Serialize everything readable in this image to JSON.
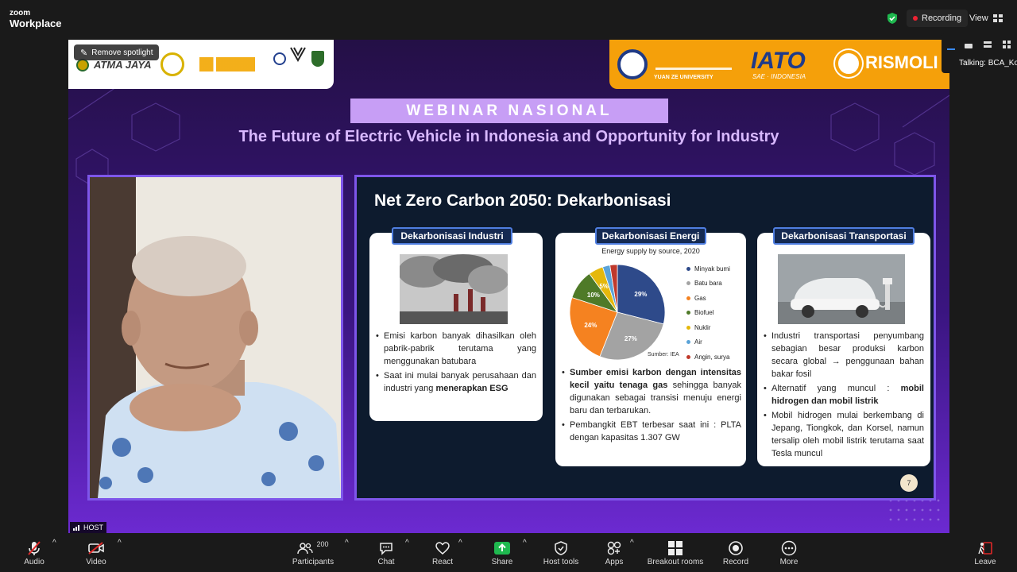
{
  "app": {
    "brand_top": "zoom",
    "brand_bottom": "Workplace"
  },
  "status": {
    "recording_label": "Recording",
    "view_label": "View"
  },
  "spotlight": {
    "remove_label": "Remove spotlight"
  },
  "banner": {
    "left_logos": [
      "ATMA JAYA"
    ],
    "right_logos": [
      "YUAN ZE UNIVERSITY",
      "IATO",
      "SAE · INDONESIA",
      "RISMOLI"
    ],
    "tag": "WEBINAR NASIONAL",
    "title": "The Future of Electric Vehicle in Indonesia and Opportunity for Industry"
  },
  "talking": {
    "label": "Talking:",
    "name": "BCA_Ko"
  },
  "host_tag": "HOST",
  "slide": {
    "title": "Net Zero Carbon 2050: Dekarbonisasi",
    "page_number": "7",
    "cards": [
      {
        "heading": "Dekarbonisasi Industri",
        "bullets": [
          "Emisi karbon banyak dihasilkan oleh pabrik-pabrik terutama yang menggunakan batubara"
        ],
        "bullet2_plain": "Saat ini mulai banyak perusahaan dan industri yang ",
        "bullet2_bold": "menerapkan ESG"
      },
      {
        "heading": "Dekarbonisasi Energi",
        "chart_caption": "Energy supply by source, 2020",
        "source": "Sumber: IEA",
        "bullet1_bold": "Sumber emisi karbon dengan intensitas kecil yaitu tenaga gas",
        "bullet1_plain": " sehingga banyak digunakan sebagai transisi menuju energi baru dan terbarukan.",
        "bullet2": "Pembangkit EBT terbesar saat ini : PLTA dengan kapasitas 1.307 GW"
      },
      {
        "heading": "Dekarbonisasi Transportasi",
        "bullets": [
          "Industri transportasi penyumbang sebagian besar produksi karbon secara global → penggunaan bahan bakar fosil"
        ],
        "bullet2_plain": "Alternatif yang muncul : ",
        "bullet2_bold": "mobil hidrogen dan mobil listrik",
        "bullet3": "Mobil hidrogen mulai berkembang di Jepang, Tiongkok, dan Korsel, namun tersalip oleh mobil listrik terutama saat Tesla muncul"
      }
    ]
  },
  "chart_data": {
    "type": "pie",
    "title": "Energy supply by source, 2020",
    "categories": [
      "Minyak bumi",
      "Batu bara",
      "Gas",
      "Biofuel",
      "Nuklir",
      "Air",
      "Angin, surya"
    ],
    "values": [
      29,
      27,
      24,
      10,
      5,
      2.5,
      2.5
    ],
    "slice_labels": [
      "29%",
      "27%",
      "24%",
      "10%",
      "5%",
      "",
      ""
    ],
    "colors": [
      "#2e4a8a",
      "#a3a3a3",
      "#f58220",
      "#4f7a28",
      "#e5b80b",
      "#5ba3d8",
      "#c0392b"
    ],
    "legend_position": "right",
    "source": "Sumber: IEA"
  },
  "toolbar": {
    "audio": "Audio",
    "video": "Video",
    "participants": "Participants",
    "participant_count": "200",
    "chat": "Chat",
    "react": "React",
    "share": "Share",
    "host_tools": "Host tools",
    "apps": "Apps",
    "breakout": "Breakout rooms",
    "record": "Record",
    "more": "More",
    "leave": "Leave"
  },
  "colors": {
    "accent": "#7e56ea",
    "share_green": "#1fb84f",
    "leave_red": "#e02828",
    "recording_dot": "#ee2233",
    "banner_orange": "#f5a00a"
  }
}
